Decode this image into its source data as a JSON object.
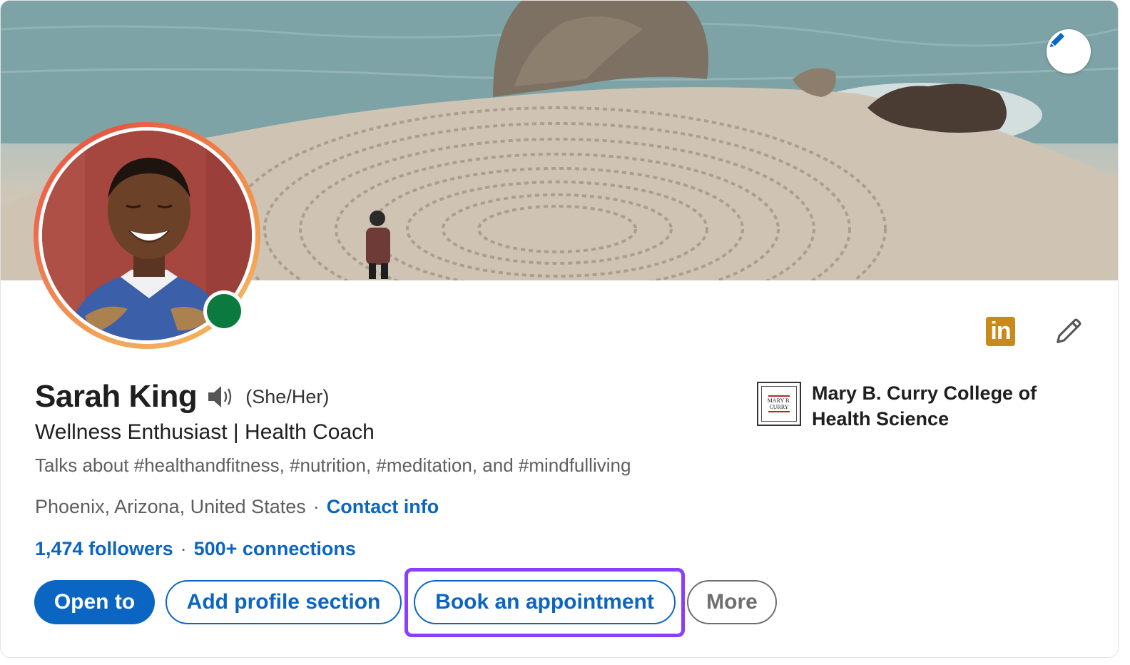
{
  "profile": {
    "name": "Sarah King",
    "pronouns": "(She/Her)",
    "headline": "Wellness Enthusiast | Health Coach",
    "talks_about": "Talks about #healthandfitness, #nutrition, #meditation, and #mindfulliving",
    "location": "Phoenix, Arizona, United States",
    "contact_label": "Contact info",
    "followers": "1,474 followers",
    "connections": "500+ connections",
    "separator": "·",
    "status": "online"
  },
  "education": {
    "logo_lines": [
      "MARY B.",
      "CURRY"
    ],
    "name": "Mary B. Curry College of Health Science"
  },
  "badge": {
    "label": "in"
  },
  "actions": {
    "open_to": "Open to",
    "add_section": "Add profile section",
    "book": "Book an appointment",
    "more": "More"
  },
  "icons": {
    "banner_edit": "pencil-icon",
    "intro_edit": "pencil-icon",
    "pronunciation": "speaker-icon",
    "badge": "linkedin-icon"
  },
  "colors": {
    "accent": "#0a66c2",
    "online": "#0b7a3e",
    "highlight": "#8a3ffc",
    "badge": "#c78a1b",
    "ring": "#ee6b4d"
  }
}
